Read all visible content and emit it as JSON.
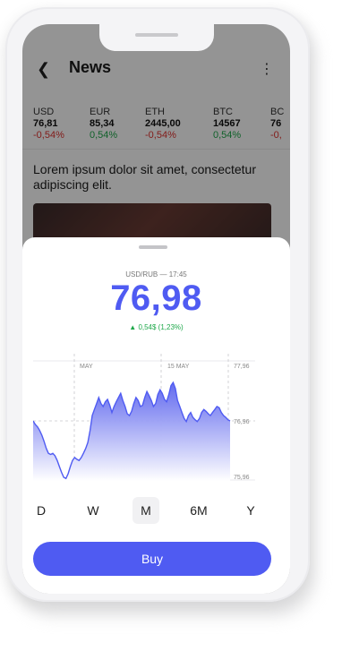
{
  "header": {
    "title": "News"
  },
  "tickers": [
    {
      "code": "USD",
      "value": "76,81",
      "change": "-0,54%",
      "trend": "down"
    },
    {
      "code": "EUR",
      "value": "85,34",
      "change": "0,54%",
      "trend": "up"
    },
    {
      "code": "ETH",
      "value": "2445,00",
      "change": "-0,54%",
      "trend": "down"
    },
    {
      "code": "BTC",
      "value": "14567",
      "change": "0,54%",
      "trend": "up"
    },
    {
      "code": "BC",
      "value": "76",
      "change": "-0,",
      "trend": "down"
    }
  ],
  "news": {
    "headline": "Lorem ipsum dolor sit amet, consectetur adipiscing elit."
  },
  "sheet": {
    "pair_time": "USD/RUB — 17:45",
    "price": "76,98",
    "change": "0,54$ (1,23%)",
    "periods": [
      "D",
      "W",
      "M",
      "6M",
      "Y"
    ],
    "active_period": "M",
    "buy_label": "Buy"
  },
  "chart_data": {
    "type": "area",
    "x_labels": [
      "MAY",
      "15 MAY"
    ],
    "y_ticks": [
      "77,96",
      "76,96",
      "75,96"
    ],
    "ylim": [
      75.96,
      77.96
    ],
    "values": [
      76.96,
      76.9,
      76.86,
      76.8,
      76.72,
      76.62,
      76.5,
      76.42,
      76.4,
      76.42,
      76.38,
      76.3,
      76.2,
      76.1,
      76.02,
      76.0,
      76.08,
      76.2,
      76.3,
      76.35,
      76.32,
      76.3,
      76.35,
      76.42,
      76.5,
      76.6,
      76.8,
      77.05,
      77.15,
      77.25,
      77.35,
      77.25,
      77.2,
      77.28,
      77.32,
      77.22,
      77.1,
      77.2,
      77.28,
      77.35,
      77.42,
      77.3,
      77.2,
      77.08,
      77.05,
      77.12,
      77.25,
      77.35,
      77.3,
      77.2,
      77.22,
      77.35,
      77.45,
      77.38,
      77.3,
      77.2,
      77.25,
      77.4,
      77.48,
      77.42,
      77.32,
      77.28,
      77.4,
      77.55,
      77.6,
      77.5,
      77.3,
      77.2,
      77.1,
      77.0,
      76.95,
      77.05,
      77.1,
      77.02,
      76.98,
      76.95,
      77.0,
      77.1,
      77.15,
      77.12,
      77.08,
      77.05,
      77.1,
      77.15,
      77.2,
      77.18,
      77.1,
      77.05,
      77.02,
      76.98,
      76.96
    ],
    "colors": {
      "line": "#4f5bf2",
      "fill_top": "#5b63ee",
      "fill_bottom": "#ffffff"
    },
    "grid": true
  }
}
